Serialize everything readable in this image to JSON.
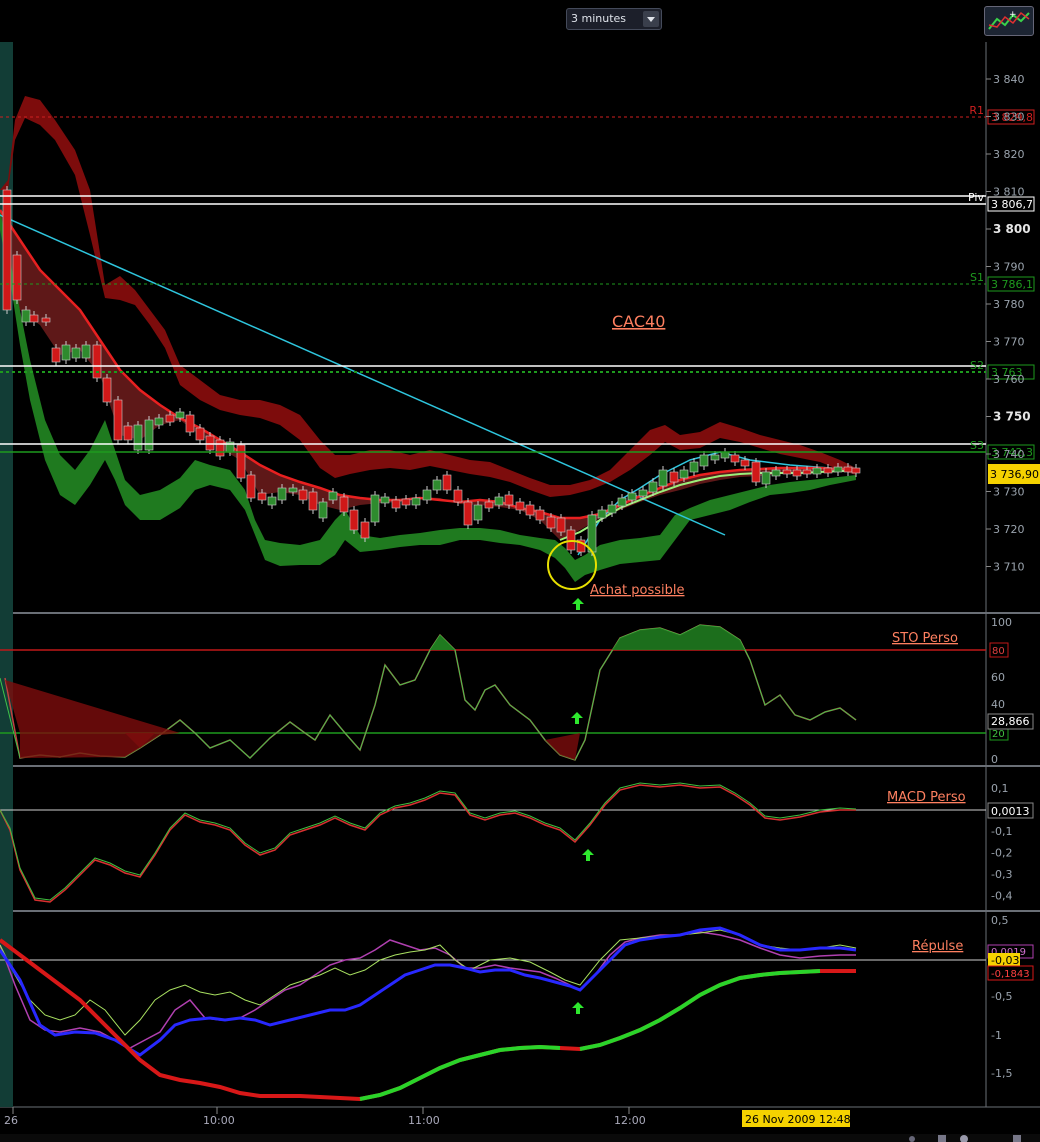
{
  "toolbar": {
    "timeframe": "3 minutes",
    "tool_icon": "chart-indicators-icon"
  },
  "price_pane": {
    "title": "CAC40",
    "annotation": "Achat possible",
    "y_ticks": [
      "3 840",
      "3 830",
      "3 820",
      "3 810",
      "3 800",
      "3 790",
      "3 780",
      "3 770",
      "3 760",
      "3 750",
      "3 740",
      "3 730",
      "3 720",
      "3 710"
    ],
    "bold_ticks": [
      "3 800",
      "3 750"
    ],
    "levels": [
      {
        "label": "R1",
        "value": "3 829,8",
        "color": "#d02020"
      },
      {
        "label": "Piv",
        "value": "3 806,7",
        "color": "#ffffff"
      },
      {
        "label": "S1",
        "value": "3 786,1",
        "color": "#1e9a1e"
      },
      {
        "label": "S2",
        "value": "3 763",
        "color": "#1e9a1e"
      },
      {
        "label": "S3",
        "value": "3 742,3",
        "color": "#1e9a1e"
      }
    ],
    "last_price": "3 736,90"
  },
  "sto_pane": {
    "title": "STO Perso",
    "y_ticks": [
      "100",
      "80",
      "60",
      "40",
      "20",
      "0"
    ],
    "upper": "80",
    "lower": "20",
    "value": "28,866"
  },
  "macd_pane": {
    "title": "MACD Perso",
    "y_ticks": [
      "0,1",
      "0",
      "-0,1",
      "-0,2",
      "-0,3",
      "-0,4"
    ],
    "value": "0,0013"
  },
  "repulse_pane": {
    "title": "Répulse",
    "y_ticks": [
      "0,5",
      "0",
      "-0,5",
      "-1",
      "-1,5"
    ],
    "value_1": "0,0019",
    "value_2": "-0,03",
    "value_3": "-0,1843"
  },
  "x_axis": {
    "labels": [
      "26",
      "10:00",
      "11:00",
      "12:00"
    ],
    "cursor_label": "26 Nov 2009 12:48"
  },
  "colors": {
    "background": "#000000",
    "bull": "#2e8b2e",
    "bear": "#d01818",
    "band_red": "#8b0d0d",
    "band_green": "#1f7a1f",
    "trend": "#32c8e0",
    "annotation": "#ff8060"
  }
}
